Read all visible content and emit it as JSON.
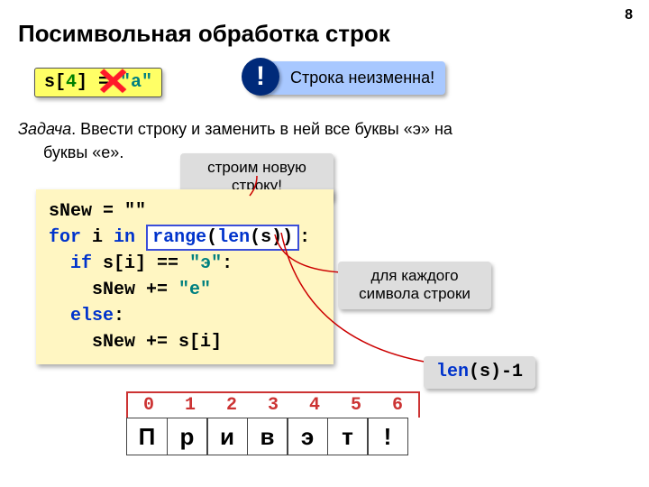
{
  "page_num": "8",
  "title": "Посимвольная обработка строк",
  "bad_code": {
    "pre": "s[",
    "idx": "4",
    "post": "] = ",
    "str": "\"a\""
  },
  "warn_icon": "!",
  "warn_text": "Строка неизменна!",
  "task": {
    "label": "Задача",
    "body1": ". Ввести строку и заменить в ней все буквы «э» на",
    "body2": "буквы «е»."
  },
  "notes": {
    "new_string": "строим новую строку!",
    "each_char": "для каждого символа строки",
    "len_expr": {
      "a": "len",
      "b": "(s)-1"
    }
  },
  "code": {
    "l1": "sNew = \"\"",
    "for": "for",
    "i_in": " i ",
    "in": "in",
    "sp": " ",
    "range": "range",
    "lparen": "(",
    "len": "len",
    "arg": "(s))",
    "colon": ":",
    "l3a": "  ",
    "if": "if",
    "l3b": " s[i] == ",
    "l3c": "\"э\"",
    "l3d": ":",
    "l4a": "    sNew += ",
    "l4b": "\"е\"",
    "else": "  else",
    "l5b": ":",
    "l6": "    sNew += s[i]"
  },
  "indices": [
    "0",
    "1",
    "2",
    "3",
    "4",
    "5",
    "6"
  ],
  "cells": [
    "П",
    "р",
    "и",
    "в",
    "э",
    "т",
    "!"
  ]
}
